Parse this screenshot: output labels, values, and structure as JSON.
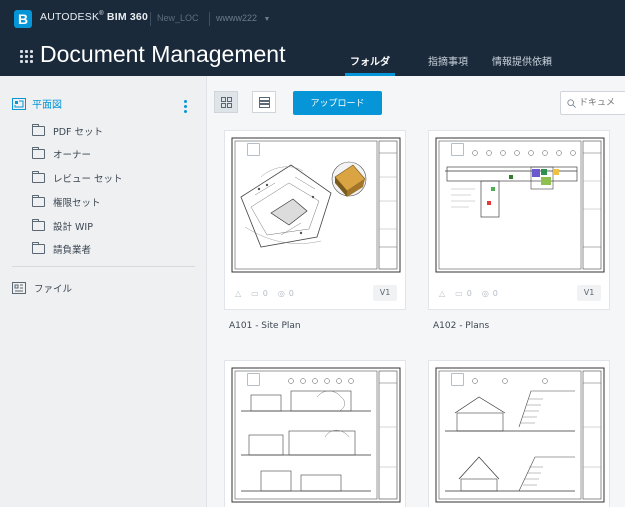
{
  "header": {
    "logo_letter": "B",
    "brand_prefix": "AUTODESK",
    "brand_product": "BIM 360",
    "project": "New_LOC",
    "project_selector": "wwww222",
    "app_title": "Document Management",
    "tabs": [
      {
        "label": "フォルダ",
        "active": true
      },
      {
        "label": "指摘事項",
        "active": false
      },
      {
        "label": "情報提供依頼",
        "active": false
      }
    ]
  },
  "sidebar": {
    "root_label": "平面図",
    "folders": [
      {
        "label": "PDF セット"
      },
      {
        "label": "オーナー"
      },
      {
        "label": "レビュー セット"
      },
      {
        "label": "権限セット"
      },
      {
        "label": "設計 WIP"
      },
      {
        "label": "請負業者"
      }
    ],
    "files_label": "ファイル"
  },
  "toolbar": {
    "upload_label": "アップロード",
    "search_placeholder": "ドキュメ"
  },
  "cards": [
    {
      "name": "A101 - Site Plan",
      "issues": "0",
      "comments": "0",
      "version": "V1"
    },
    {
      "name": "A102 - Plans",
      "issues": "0",
      "comments": "0",
      "version": "V1"
    },
    {
      "name": "",
      "issues": "",
      "comments": "",
      "version": ""
    },
    {
      "name": "",
      "issues": "",
      "comments": "",
      "version": ""
    }
  ],
  "colors": {
    "header_bg": "#1b2a3a",
    "accent": "#0696d7",
    "sidebar_bg": "#eef0f2"
  }
}
